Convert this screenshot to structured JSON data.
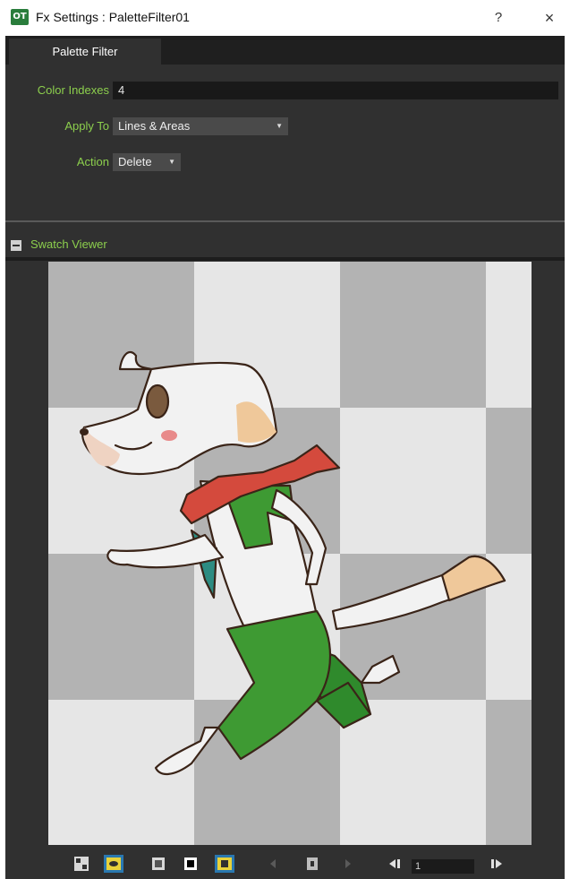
{
  "window": {
    "app_icon_text": "OT",
    "title": "Fx Settings : PaletteFilter01",
    "help_label": "?",
    "close_label": "×"
  },
  "tabs": [
    {
      "label": "Palette Filter",
      "active": true
    }
  ],
  "form": {
    "color_indexes": {
      "label": "Color Indexes",
      "value": "4"
    },
    "apply_to": {
      "label": "Apply To",
      "value": "Lines & Areas"
    },
    "action": {
      "label": "Action",
      "value": "Delete"
    }
  },
  "swatch_viewer": {
    "title": "Swatch Viewer",
    "collapsed": false
  },
  "toolbar": {
    "frame_value": "1",
    "buttons": [
      {
        "name": "compare-icon",
        "active": false
      },
      {
        "name": "eye-icon",
        "active": true
      },
      {
        "name": "checkerboard-icon",
        "active": false
      },
      {
        "name": "black-bg-icon",
        "active": false
      },
      {
        "name": "white-bg-icon",
        "active": true
      },
      {
        "name": "prev-icon",
        "active": false
      },
      {
        "name": "lock-icon",
        "active": false
      },
      {
        "name": "next-icon",
        "active": false
      },
      {
        "name": "first-frame-icon",
        "active": false
      },
      {
        "name": "last-frame-icon",
        "active": false
      }
    ]
  },
  "colors": {
    "accent_label": "#8ccf4d",
    "panel_bg": "#303030",
    "active_button": "#2a78b0",
    "character_green": "#3e9a33",
    "scarf_red": "#d44a3d",
    "teal": "#2d8c82",
    "skin": "#efc89a"
  }
}
